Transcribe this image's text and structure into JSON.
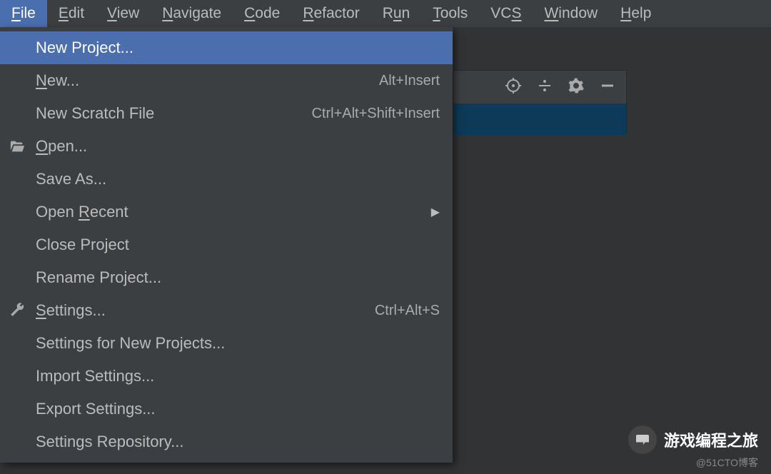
{
  "menu": {
    "file": {
      "pre": "",
      "u": "F",
      "post": "ile"
    },
    "edit": {
      "pre": "",
      "u": "E",
      "post": "dit"
    },
    "view": {
      "pre": "",
      "u": "V",
      "post": "iew"
    },
    "navigate": {
      "pre": "",
      "u": "N",
      "post": "avigate"
    },
    "code": {
      "pre": "",
      "u": "C",
      "post": "ode"
    },
    "refactor": {
      "pre": "",
      "u": "R",
      "post": "efactor"
    },
    "run": {
      "pre": "R",
      "u": "u",
      "post": "n"
    },
    "tools": {
      "pre": "",
      "u": "T",
      "post": "ools"
    },
    "vcs": {
      "pre": "VC",
      "u": "S",
      "post": ""
    },
    "window": {
      "pre": "",
      "u": "W",
      "post": "indow"
    },
    "help": {
      "pre": "",
      "u": "H",
      "post": "elp"
    }
  },
  "dropdown": {
    "new_project": "New Project...",
    "new": {
      "pre": "",
      "u": "N",
      "post": "ew..."
    },
    "new_shortcut": "Alt+Insert",
    "new_scratch": "New Scratch File",
    "new_scratch_shortcut": "Ctrl+Alt+Shift+Insert",
    "open": {
      "pre": "",
      "u": "O",
      "post": "pen..."
    },
    "save_as": "Save As...",
    "open_recent": {
      "pre": "Open ",
      "u": "R",
      "post": "ecent"
    },
    "close_project": "Close Project",
    "rename_project": "Rename Project...",
    "settings": {
      "pre": "",
      "u": "S",
      "post": "ettings..."
    },
    "settings_shortcut": "Ctrl+Alt+S",
    "settings_new_proj": "Settings for New Projects...",
    "import_settings": "Import Settings...",
    "export_settings": "Export Settings...",
    "settings_repo": "Settings Repository..."
  },
  "watermark": {
    "title": "游戏编程之旅",
    "sub": "@51CTO博客"
  }
}
